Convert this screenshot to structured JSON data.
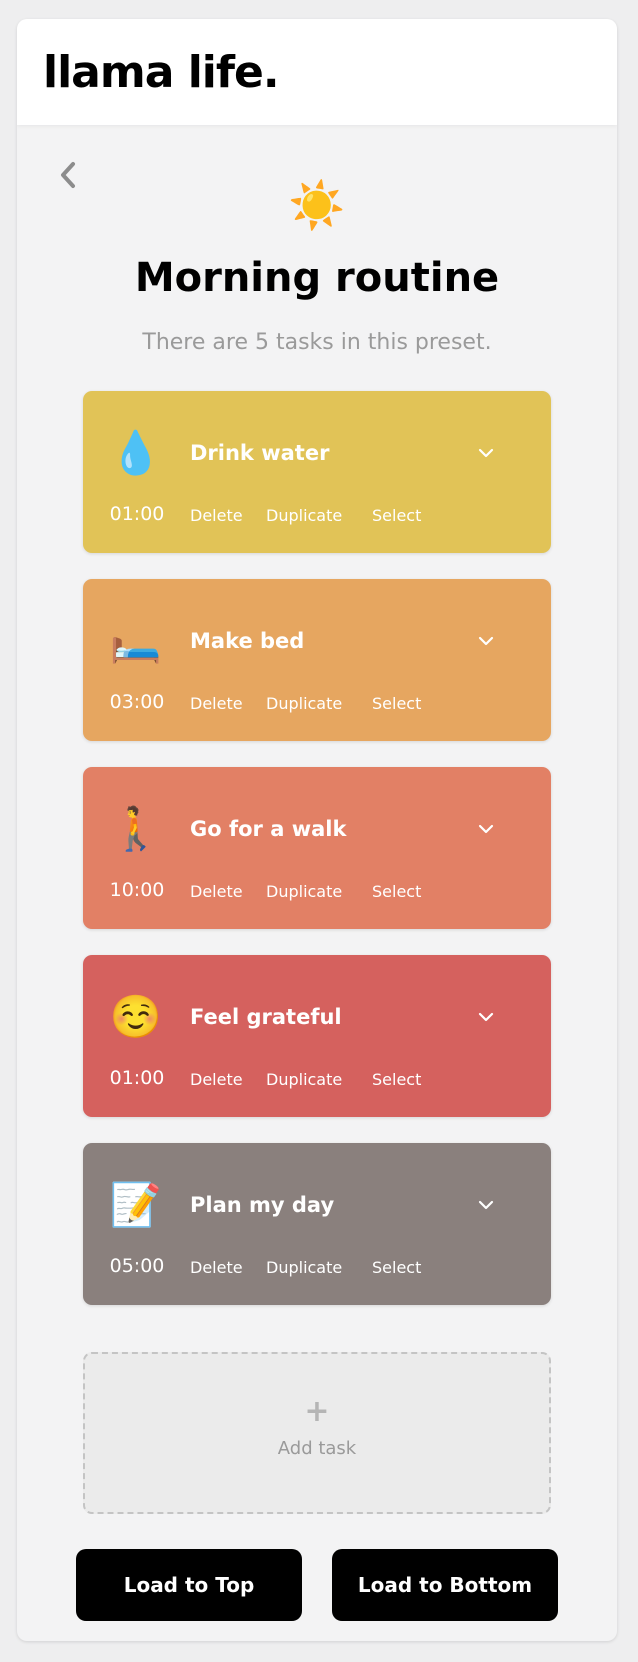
{
  "app": {
    "logo": "llama life."
  },
  "preset": {
    "icon": "☀️",
    "title": "Morning routine",
    "subtitle": "There are 5 tasks in this preset."
  },
  "task_actions": {
    "delete": "Delete",
    "duplicate": "Duplicate",
    "select": "Select"
  },
  "tasks": [
    {
      "emoji": "💧",
      "name": "Drink water",
      "time": "01:00",
      "color": "#e1c357"
    },
    {
      "emoji": "🛏️",
      "name": "Make bed",
      "time": "03:00",
      "color": "#e6a660"
    },
    {
      "emoji": "🚶",
      "name": "Go for a walk",
      "time": "10:00",
      "color": "#e28065"
    },
    {
      "emoji": "☺️",
      "name": "Feel grateful",
      "time": "01:00",
      "color": "#d5615e"
    },
    {
      "emoji": "📝",
      "name": "Plan my day",
      "time": "05:00",
      "color": "#8a807d"
    }
  ],
  "add_task": {
    "icon": "+",
    "label": "Add task"
  },
  "buttons": {
    "load_top": "Load to Top",
    "load_bottom": "Load to Bottom"
  }
}
